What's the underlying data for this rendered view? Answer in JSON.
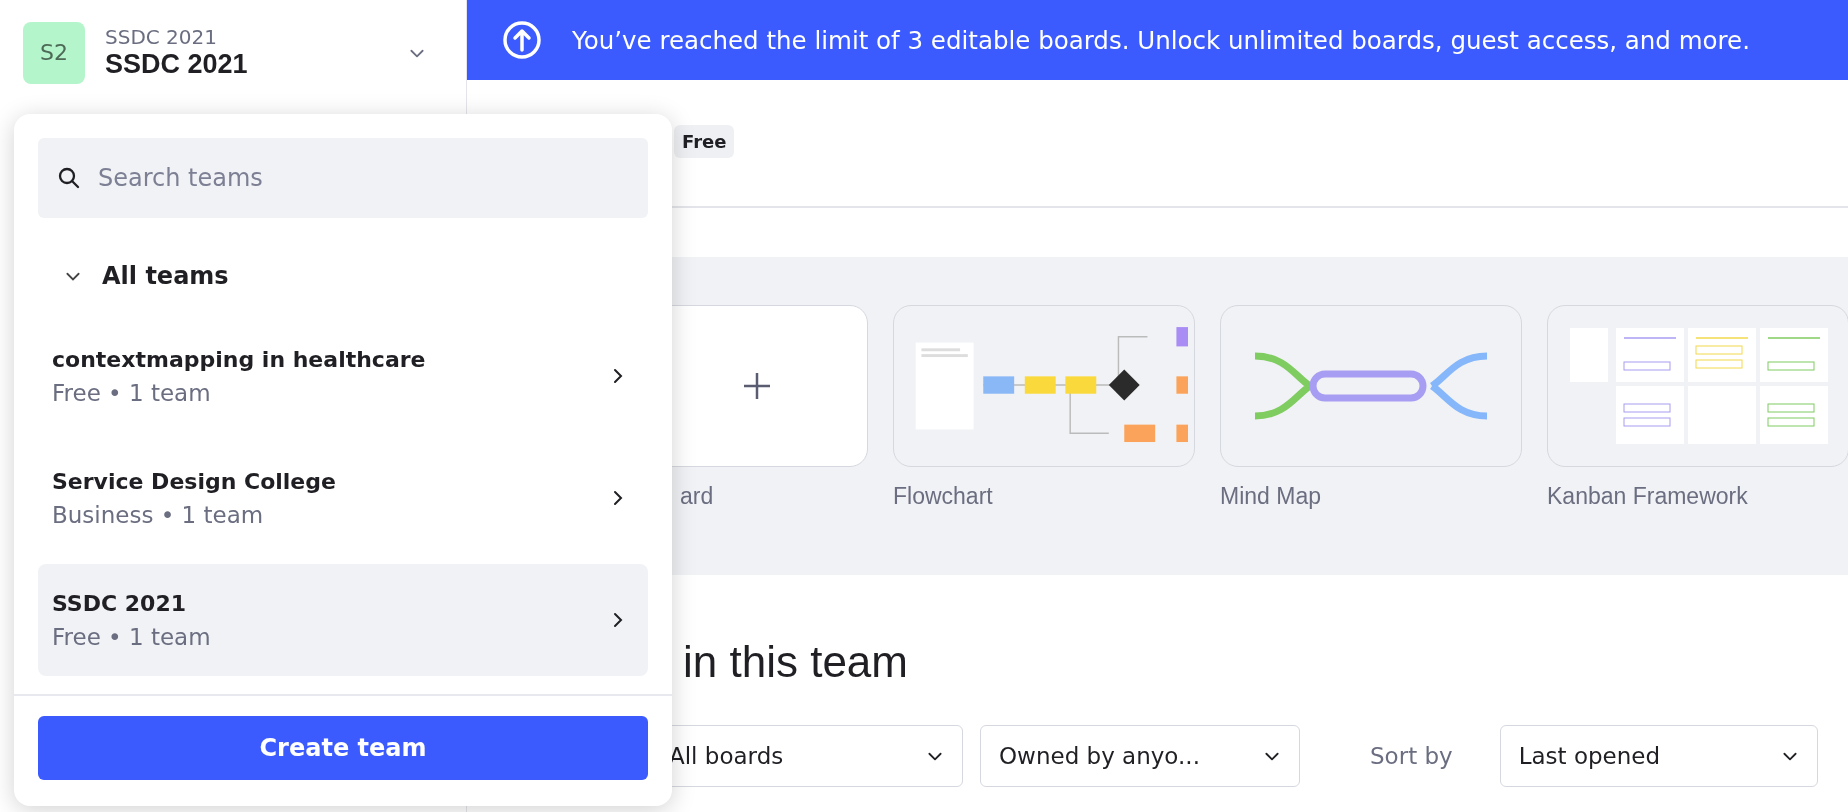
{
  "team_switcher": {
    "avatar": "S2",
    "subtitle": "SSDC 2021",
    "title": "SSDC 2021"
  },
  "banner": {
    "text": "You’ve reached the limit of 3 editable boards. Unlock unlimited boards, guest access, and more."
  },
  "plan_badge": "Free",
  "templates": [
    {
      "kind": "blank",
      "label": "ard"
    },
    {
      "kind": "flowchart",
      "label": "Flowchart"
    },
    {
      "kind": "mindmap",
      "label": "Mind Map"
    },
    {
      "kind": "kanban",
      "label": "Kanban Framework"
    }
  ],
  "section_title": "in this team",
  "filters": [
    {
      "kind": "select",
      "value": "All boards"
    },
    {
      "kind": "select",
      "value": "Owned by anyo..."
    },
    {
      "kind": "label",
      "value": "Sort by"
    },
    {
      "kind": "select",
      "value": "Last opened"
    }
  ],
  "dropdown": {
    "search": {
      "placeholder": "Search teams"
    },
    "group": {
      "label": "All teams",
      "expanded": true
    },
    "teams": [
      {
        "name": "contextmapping in healthcare",
        "detail": "Free • 1 team",
        "selected": false
      },
      {
        "name": "Service Design College",
        "detail": "Business • 1 team",
        "selected": false
      },
      {
        "name": "SSDC 2021",
        "detail": "Free • 1 team",
        "selected": true
      }
    ],
    "button": "Create team"
  }
}
